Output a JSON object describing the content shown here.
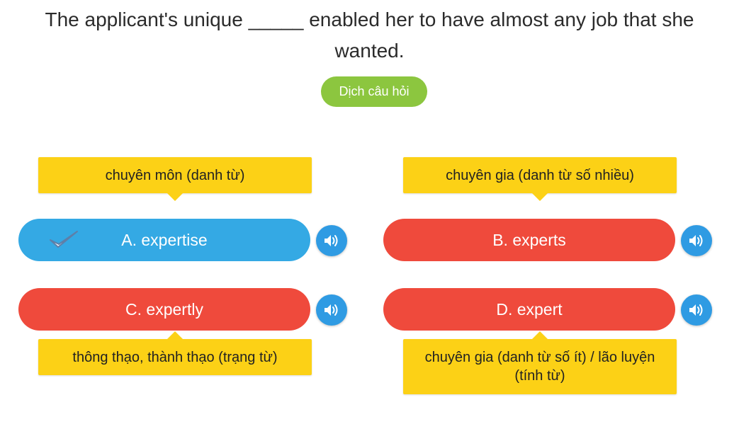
{
  "question": {
    "text": "The applicant's unique _____ enabled her to have almost any job that she wanted.",
    "translate_label": "Dịch câu hỏi"
  },
  "options": [
    {
      "label": "A. expertise",
      "hint": "chuyên môn (danh từ)",
      "state": "correct",
      "color": "#34a9e4"
    },
    {
      "label": "B. experts",
      "hint": "chuyên gia (danh từ số nhiều)",
      "state": "wrong",
      "color": "#ef4a3c"
    },
    {
      "label": "C. expertly",
      "hint": "thông thạo, thành thạo (trạng từ)",
      "state": "wrong",
      "color": "#ef4a3c"
    },
    {
      "label": "D. expert",
      "hint": "chuyên gia (danh từ số ít) / lão luyện (tính từ)",
      "state": "wrong",
      "color": "#ef4a3c"
    }
  ],
  "icons": {
    "check": "checkmark-icon",
    "speaker": "speaker-icon"
  },
  "colors": {
    "hint_background": "#fcd116",
    "translate_button": "#8cc63f",
    "speaker_button": "#2f9be3"
  }
}
